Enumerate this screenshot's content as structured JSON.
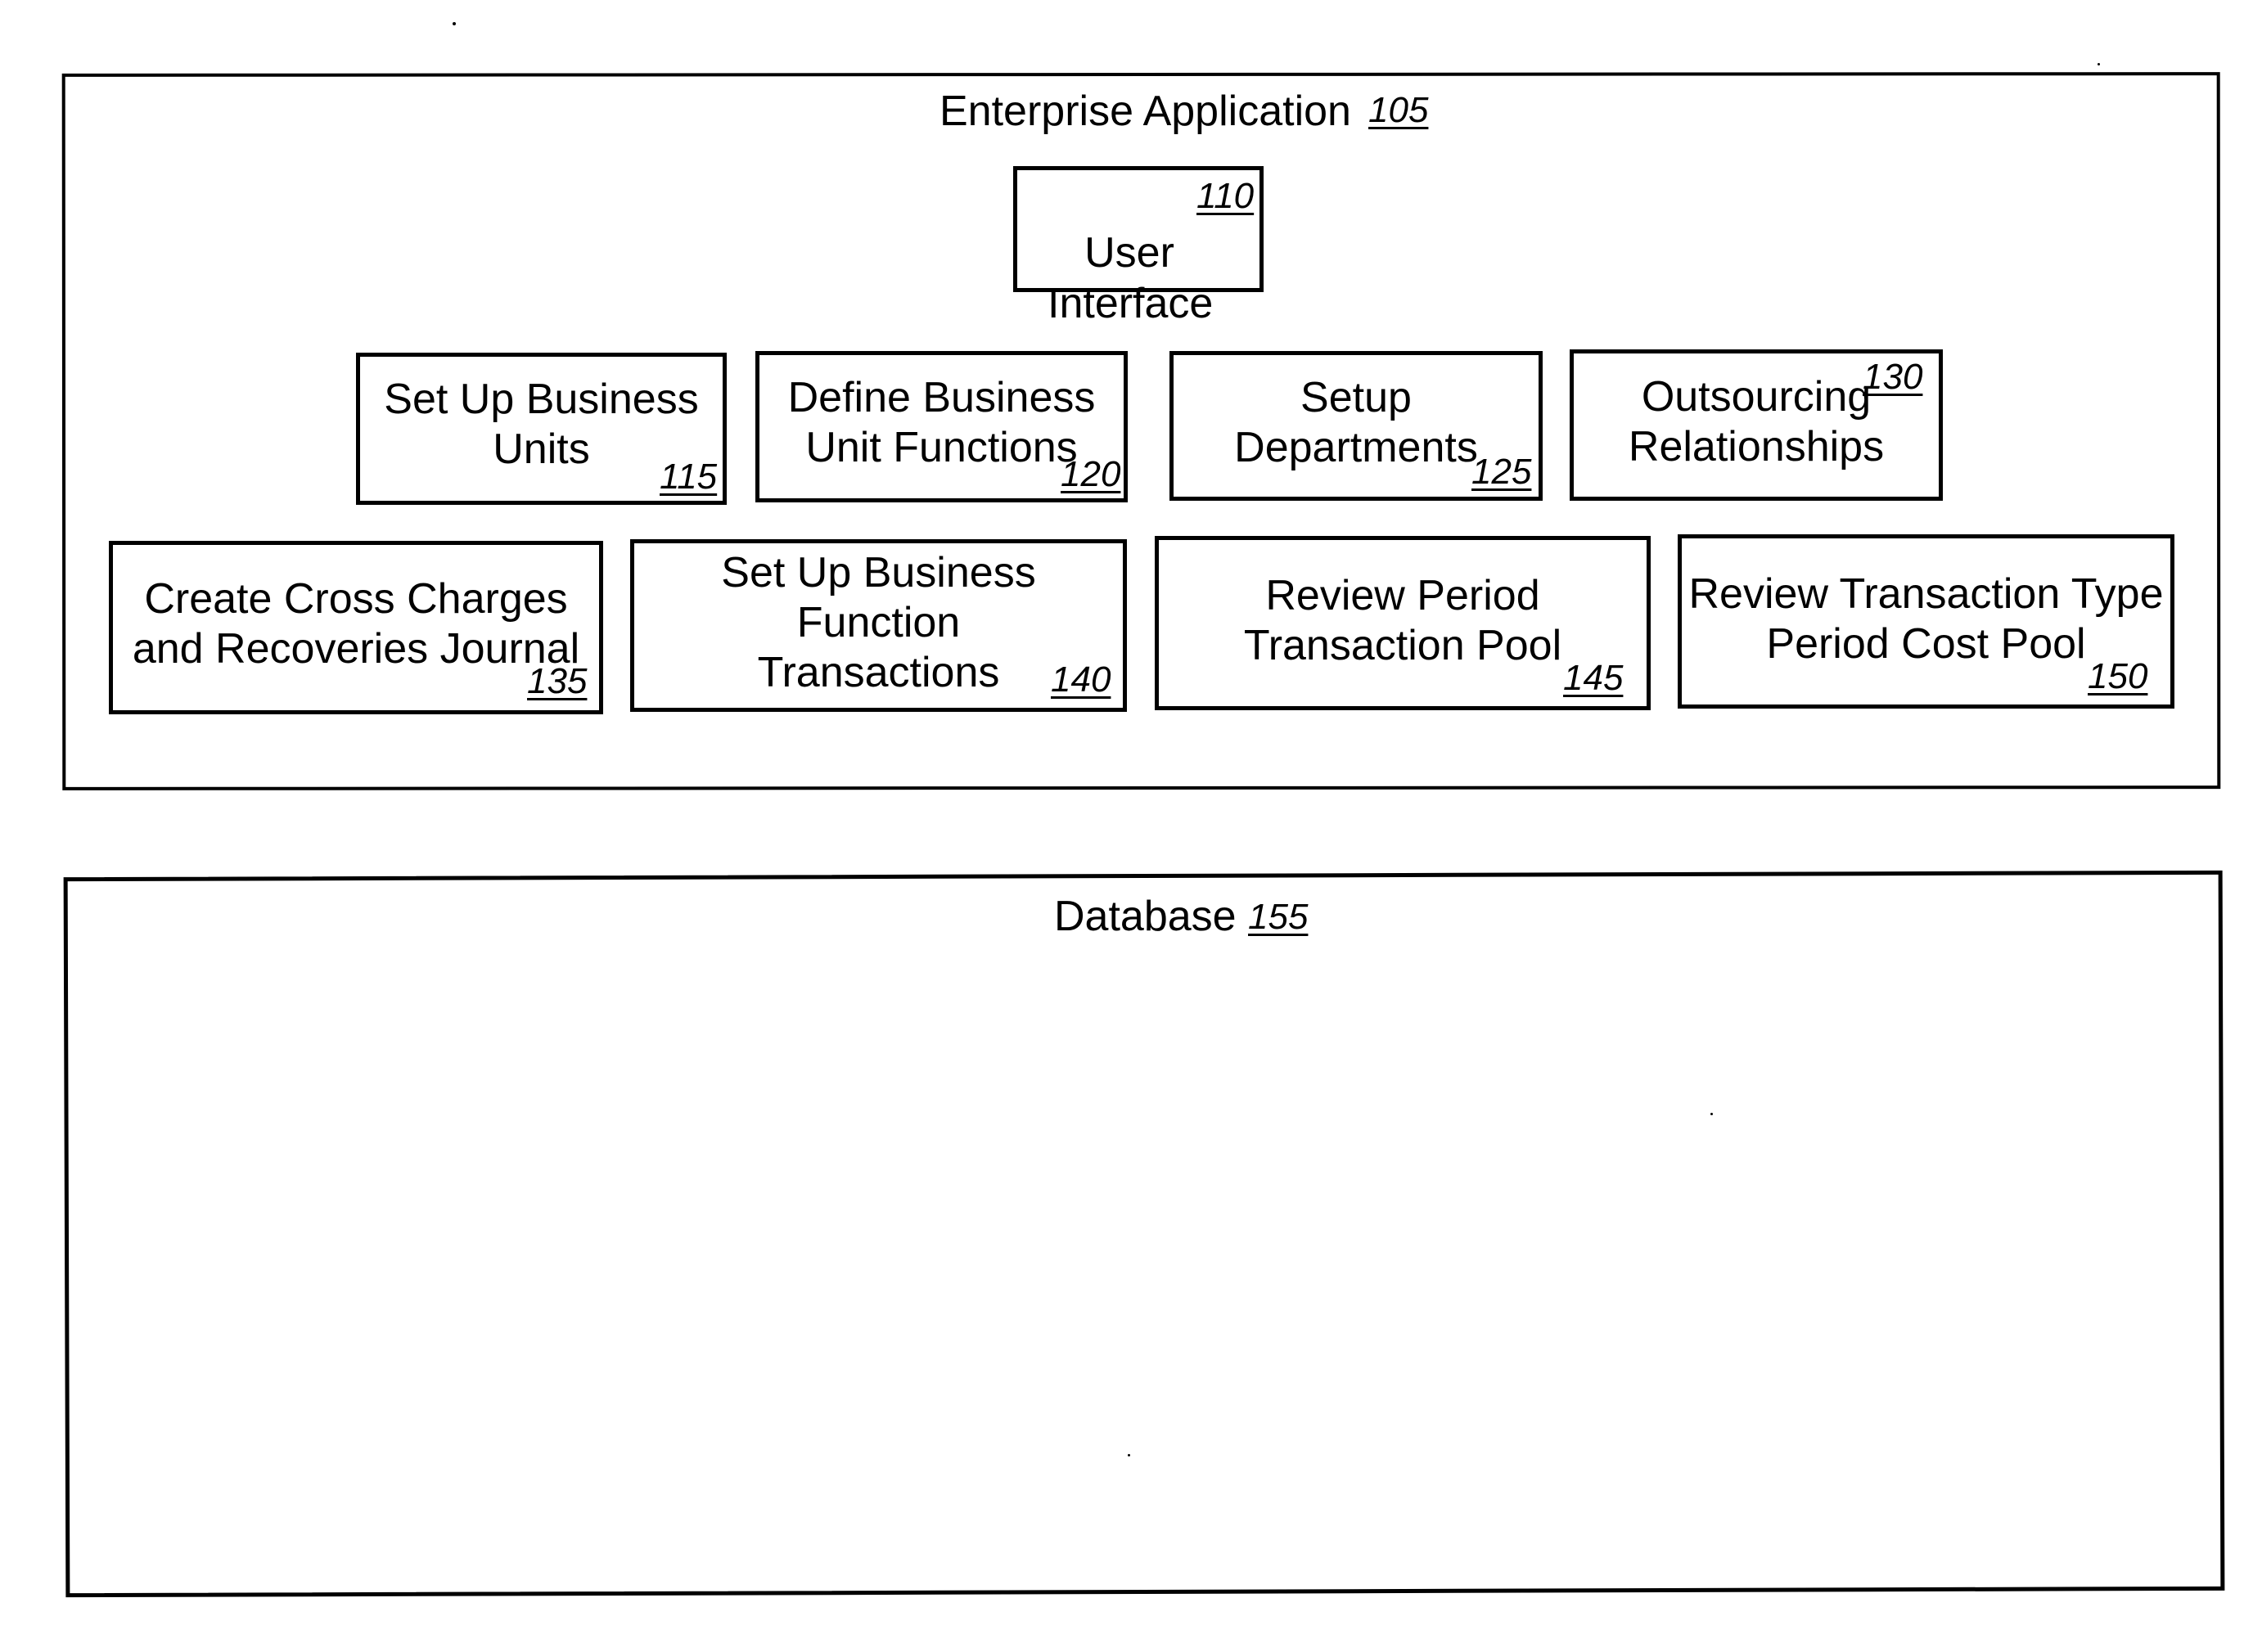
{
  "enterprise_application": {
    "title": "Enterprise Application",
    "ref": "105",
    "components": [
      {
        "id": "user-interface",
        "label": "User\nInterface",
        "ref": "110"
      },
      {
        "id": "set-up-business-units",
        "label": "Set Up Business\nUnits",
        "ref": "115"
      },
      {
        "id": "define-business-unit-functions",
        "label": "Define Business\nUnit Functions",
        "ref": "120"
      },
      {
        "id": "setup-departments",
        "label": "Setup\nDepartments",
        "ref": "125"
      },
      {
        "id": "outsourcing-relationships",
        "label": "Outsourcing\nRelationships",
        "ref": "130"
      },
      {
        "id": "create-cross-charges",
        "label": "Create Cross Charges\nand Recoveries Journal",
        "ref": "135"
      },
      {
        "id": "set-up-business-function-transactions",
        "label": "Set Up Business\nFunction\nTransactions",
        "ref": "140"
      },
      {
        "id": "review-period-transaction-pool",
        "label": "Review Period\nTransaction Pool",
        "ref": "145"
      },
      {
        "id": "review-transaction-type-period-cost-pool",
        "label": "Review Transaction Type\nPeriod Cost Pool",
        "ref": "150"
      }
    ]
  },
  "database": {
    "title": "Database",
    "ref": "155"
  }
}
